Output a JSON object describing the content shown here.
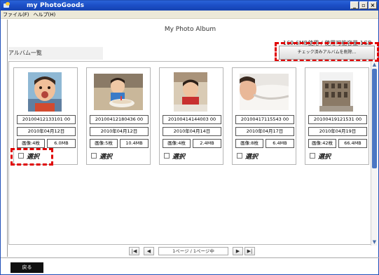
{
  "window": {
    "title": "my PhotoGoods"
  },
  "menu": [
    "ファイル(F)",
    "ヘルプ(H)"
  ],
  "header": {
    "album_title": "My Photo Album",
    "usage": "169.6MB使用 / 使用可能容量:1GB",
    "delete_button": "チェック済みアルバムを削除...",
    "list_label": "アルバム一覧"
  },
  "albums": [
    {
      "id": "20100412133101 00",
      "date": "2010年04月12日",
      "count": "画像:4枚",
      "size": "6.0MB",
      "select": "選択"
    },
    {
      "id": "20100412180436 00",
      "date": "2010年04月12日",
      "count": "画像:5枚",
      "size": "10.4MB",
      "select": "選択"
    },
    {
      "id": "20100414144003 00",
      "date": "2010年04月14日",
      "count": "画像:4枚",
      "size": "2.4MB",
      "select": "選択"
    },
    {
      "id": "20100417115543 00",
      "date": "2010年04月17日",
      "count": "画像:8枚",
      "size": "6.4MB",
      "select": "選択"
    },
    {
      "id": "20100419121531 00",
      "date": "2010年04月19日",
      "count": "画像:42枚",
      "size": "66.4MB",
      "select": "選択"
    }
  ],
  "pager": {
    "label": "1ページ / 1ページ中",
    "first": "|◀",
    "prev": "◀",
    "next": "▶",
    "last": "▶|"
  },
  "footer": {
    "back": "戻る"
  },
  "colors": {
    "titlebar": "#1c4fc7",
    "highlight": "#e00000",
    "scroll_thumb": "#4b76c3"
  }
}
